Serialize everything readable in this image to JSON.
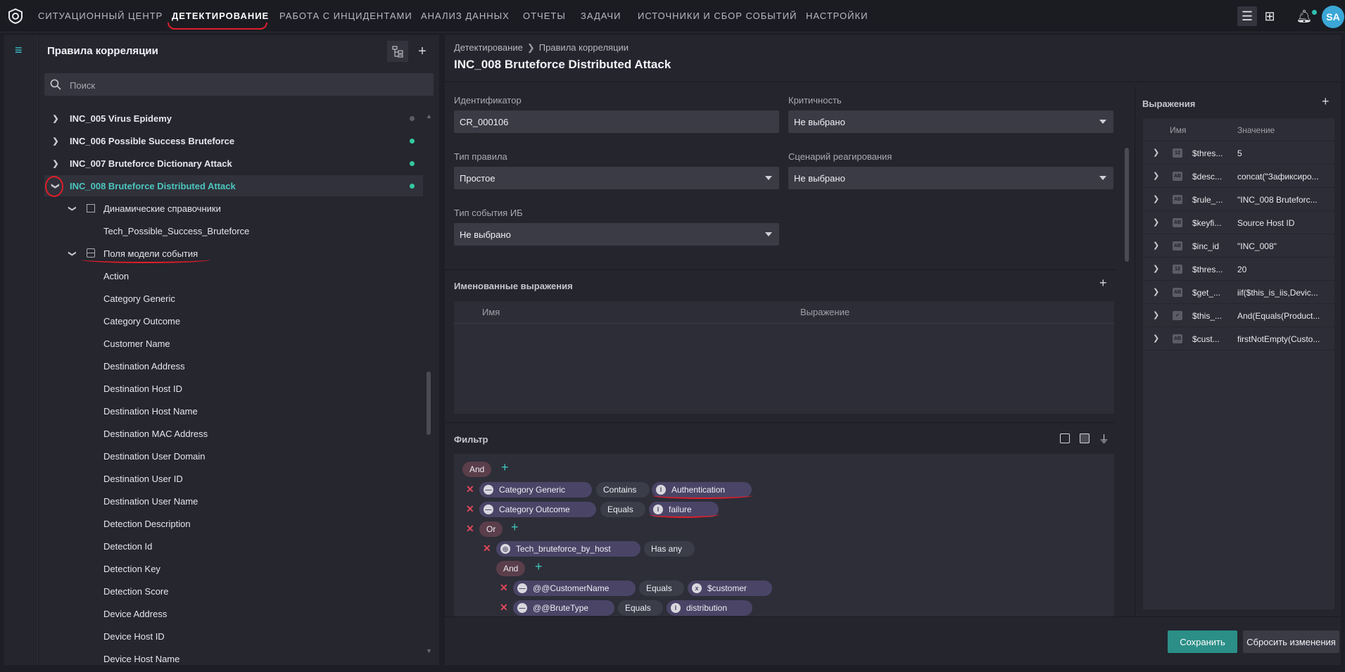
{
  "nav": [
    "СИТУАЦИОННЫЙ ЦЕНТР",
    "ДЕТЕКТИРОВАНИЕ",
    "РАБОТА С ИНЦИДЕНТАМИ",
    "АНАЛИЗ ДАННЫХ",
    "ОТЧЕТЫ",
    "ЗАДАЧИ",
    "ИСТОЧНИКИ И СБОР СОБЫТИЙ",
    "НАСТРОЙКИ"
  ],
  "user_initials": "SA",
  "tree": {
    "title": "Правила корреляции",
    "search_placeholder": "Поиск",
    "items": [
      {
        "label": "INC_005 Virus Epidemy",
        "status": "grey"
      },
      {
        "label": "INC_006 Possible Success Bruteforce",
        "status": "green"
      },
      {
        "label": "INC_007 Bruteforce Dictionary Attack",
        "status": "green"
      },
      {
        "label": "INC_008 Bruteforce Distributed Attack",
        "status": "green"
      }
    ],
    "dyn_dicts": "Динамические справочники",
    "dyn_dict_child": "Tech_Possible_Success_Bruteforce",
    "event_fields": "Поля модели события",
    "fields": [
      "Action",
      "Category Generic",
      "Category Outcome",
      "Customer Name",
      "Destination Address",
      "Destination Host ID",
      "Destination Host Name",
      "Destination MAC Address",
      "Destination User Domain",
      "Destination User ID",
      "Destination User Name",
      "Detection Description",
      "Detection Id",
      "Detection Key",
      "Detection Score",
      "Device Address",
      "Device Host ID",
      "Device Host Name"
    ]
  },
  "breadcrumb": {
    "parent": "Детектирование",
    "current": "Правила корреляции"
  },
  "rule_title": "INC_008 Bruteforce Distributed Attack",
  "form": {
    "id_label": "Идентификатор",
    "id_value": "CR_000106",
    "crit_label": "Критичность",
    "crit_value": "Не выбрано",
    "type_label": "Тип правила",
    "type_value": "Простое",
    "scenario_label": "Сценарий реагирования",
    "scenario_value": "Не выбрано",
    "event_type_label": "Тип события ИБ",
    "event_type_value": "Не выбрано"
  },
  "named_expr": {
    "title": "Именованные выражения",
    "col_name": "Имя",
    "col_expr": "Выражение"
  },
  "filter": {
    "title": "Фильтр",
    "and1": "And",
    "c1": {
      "field": "Category Generic",
      "op": "Contains",
      "value": "Authentication"
    },
    "c2": {
      "field": "Category Outcome",
      "op": "Equals",
      "value": "failure"
    },
    "or": "Or",
    "c3": {
      "field": "Tech_bruteforce_by_host",
      "op": "Has any"
    },
    "and2": "And",
    "c4": {
      "field": "@@CustomerName",
      "op": "Equals",
      "value": "$customer"
    },
    "c5": {
      "field": "@@BruteType",
      "op": "Equals",
      "value": "distribution"
    }
  },
  "expressions": {
    "title": "Выражения",
    "col_name": "Имя",
    "col_value": "Значение",
    "rows": [
      {
        "icon": "12",
        "name": "$thres...",
        "value": "5"
      },
      {
        "icon": "AB",
        "name": "$desc...",
        "value": "concat(\"Зафиксиро..."
      },
      {
        "icon": "AB",
        "name": "$rule_...",
        "value": "\"INC_008 Bruteforc..."
      },
      {
        "icon": "AB",
        "name": "$keyfi...",
        "value": "Source Host ID"
      },
      {
        "icon": "AB",
        "name": "$inc_id",
        "value": "\"INC_008\""
      },
      {
        "icon": "12",
        "name": "$thres...",
        "value": "20"
      },
      {
        "icon": "AB",
        "name": "$get_...",
        "value": "iif($this_is_iis,Devic..."
      },
      {
        "icon": "chk",
        "name": "$this_...",
        "value": "And(Equals(Product..."
      },
      {
        "icon": "AB",
        "name": "$cust...",
        "value": "firstNotEmpty(Custo..."
      }
    ]
  },
  "footer": {
    "save": "Сохранить",
    "reset": "Сбросить изменения"
  }
}
